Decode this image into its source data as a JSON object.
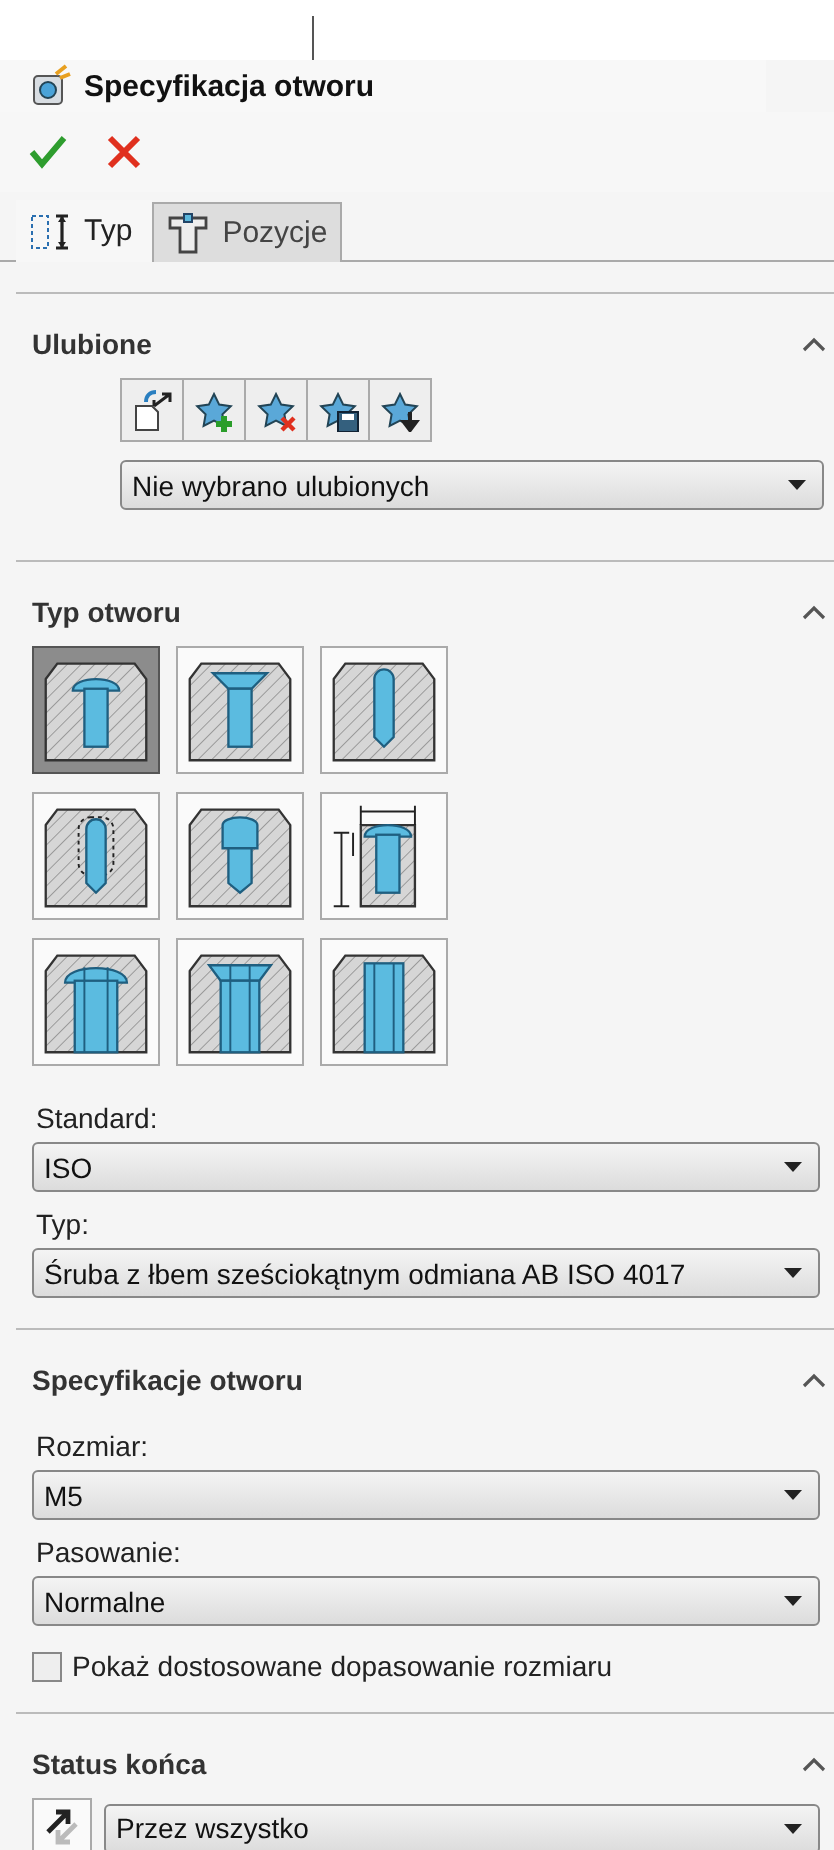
{
  "window": {
    "title": "Specyfikacja otworu"
  },
  "tabs": [
    {
      "label": "Typ",
      "selected": true,
      "kind": "type"
    },
    {
      "label": "Pozycje",
      "selected": false,
      "kind": "position"
    }
  ],
  "favorites": {
    "title": "Ulubione",
    "expanded": true,
    "dropdown": "Nie wybrano ulubionych"
  },
  "hole_type": {
    "title": "Typ otworu",
    "expanded": true,
    "types": [
      {
        "kind": "counterbore",
        "selected": true
      },
      {
        "kind": "countersink",
        "selected": false
      },
      {
        "kind": "hole",
        "selected": false
      },
      {
        "kind": "tap",
        "selected": false
      },
      {
        "kind": "tapered",
        "selected": false
      },
      {
        "kind": "legacy",
        "selected": false
      },
      {
        "kind": "counterbore_slot",
        "selected": false
      },
      {
        "kind": "countersink_slot",
        "selected": false
      },
      {
        "kind": "slot",
        "selected": false
      }
    ],
    "fields": [
      {
        "label": "Standard:",
        "value": "ISO"
      },
      {
        "label": "Typ:",
        "value": "Śruba z łbem sześciokątnym odmiana AB ISO 4017"
      }
    ]
  },
  "hole_specification": {
    "title": "Specyfikacje otworu",
    "expanded": true,
    "fields": [
      {
        "label": "Rozmiar:",
        "value": "M5"
      },
      {
        "label": "Pasowanie:",
        "value": "Normalne"
      }
    ],
    "checkbox": {
      "label": "Pokaż dostosowane dopasowanie rozmiaru",
      "checked": false
    }
  },
  "end_condition": {
    "title": "Status końca",
    "expanded": true,
    "value": "Przez wszystko"
  }
}
